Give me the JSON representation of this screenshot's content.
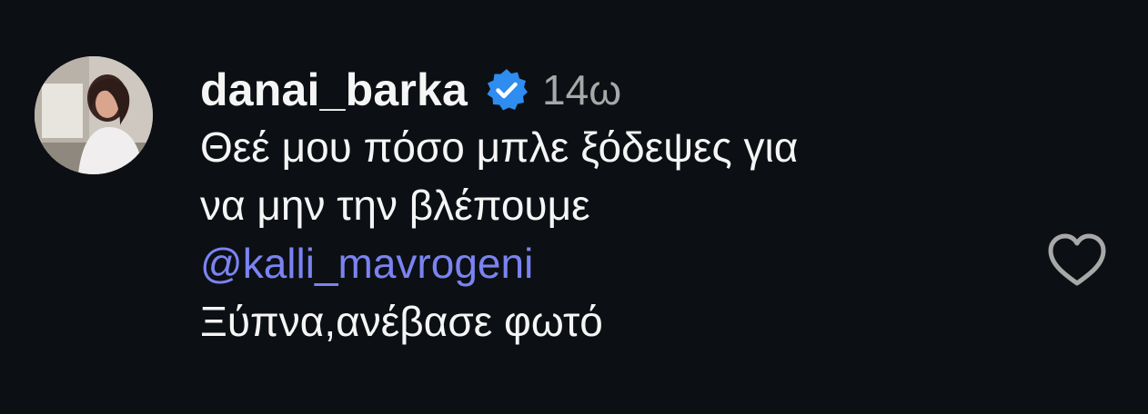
{
  "comment": {
    "username": "danai_barka",
    "time": "14ω",
    "text_lines": [
      "Θεέ μου πόσο μπλε ξόδεψες για",
      "να μην την βλέπουμε"
    ],
    "mention": "@kalli_mavrogeni",
    "reply_line": "Ξύπνα,ανέβασε φωτό"
  },
  "icons": {
    "verified": "verified-badge-icon",
    "like": "heart-outline-icon"
  },
  "colors": {
    "background": "#0c1014",
    "text": "#f5f5f5",
    "muted": "#a8a8a8",
    "mention": "#7b83f2",
    "verified": "#2f8cf0"
  }
}
